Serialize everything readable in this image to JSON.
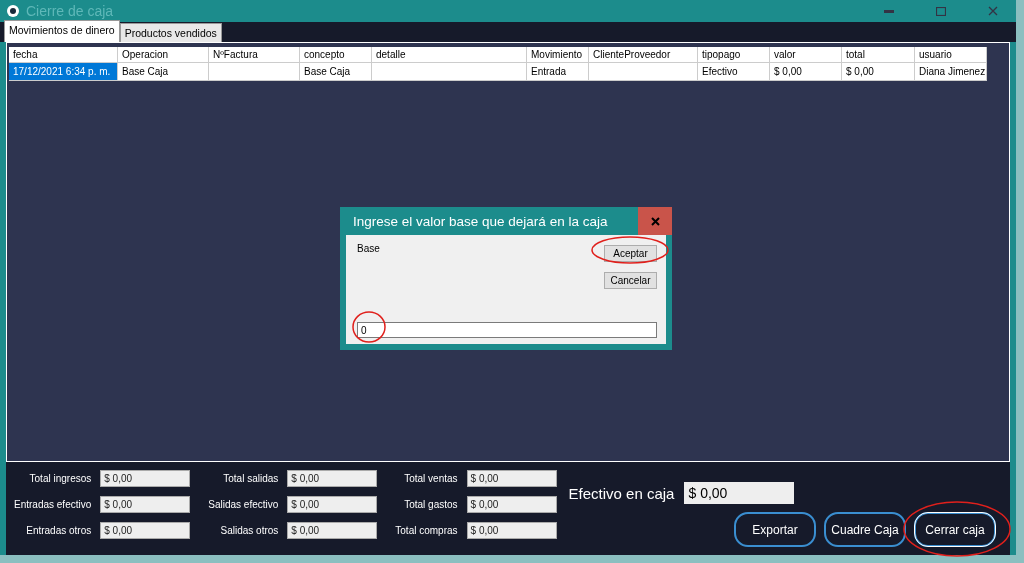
{
  "window": {
    "title": "Cierre de caja"
  },
  "tabs": [
    {
      "label": "Movimientos de dinero",
      "selected": true
    },
    {
      "label": "Productos vendidos",
      "selected": false
    }
  ],
  "table": {
    "columns": [
      "fecha",
      "Operacion",
      "NºFactura",
      "concepto",
      "detalle",
      "Movimiento",
      "ClienteProveedor",
      "tipopago",
      "valor",
      "total",
      "usuario"
    ],
    "rows": [
      {
        "selected": true,
        "cells": [
          "17/12/2021 6:34 p. m.",
          "Base Caja",
          "",
          "Base Caja",
          "",
          "Entrada",
          "",
          "Efectivo",
          "$ 0,00",
          "$ 0,00",
          "Diana Jimenez"
        ]
      }
    ]
  },
  "dialog": {
    "title": "Ingrese el valor base que dejará en la caja",
    "label": "Base",
    "value": "0",
    "value_circled": true,
    "buttons": [
      {
        "label": "Aceptar",
        "circled": true
      },
      {
        "label": "Cancelar",
        "circled": false
      }
    ]
  },
  "totals": [
    {
      "label": "Total ingresos",
      "value": "$ 0,00"
    },
    {
      "label": "Total salidas",
      "value": "$ 0,00"
    },
    {
      "label": "Total ventas",
      "value": "$ 0,00"
    },
    {
      "label": "Entradas efectivo",
      "value": "$ 0,00"
    },
    {
      "label": "Salidas efectivo",
      "value": "$ 0,00"
    },
    {
      "label": "Total gastos",
      "value": "$ 0,00"
    },
    {
      "label": "Entradas otros",
      "value": "$ 0,00"
    },
    {
      "label": "Salidas otros",
      "value": "$ 0,00"
    },
    {
      "label": "Total compras",
      "value": "$ 0,00"
    }
  ],
  "cash": {
    "label": "Efectivo en caja",
    "value": "$ 0,00"
  },
  "actions": [
    {
      "label": "Exportar",
      "focused": false,
      "circled": false
    },
    {
      "label": "Cuadre Caja",
      "focused": false,
      "circled": false
    },
    {
      "label": "Cerrar caja",
      "focused": true,
      "circled": true
    }
  ]
}
